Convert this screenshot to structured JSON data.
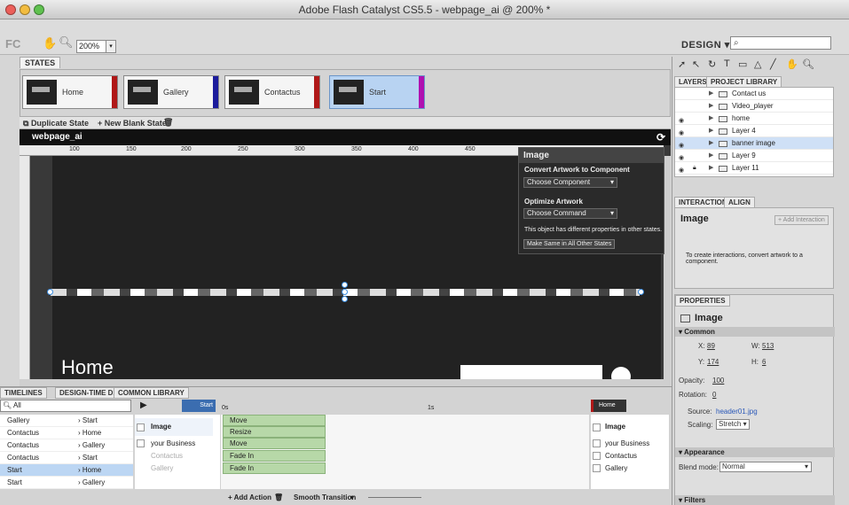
{
  "window": {
    "title": "Adobe Flash Catalyst CS5.5 - webpage_ai @ 200% *"
  },
  "toolbar": {
    "logo": "FC",
    "zoom": "200%",
    "workspace": "DESIGN",
    "search_placeholder": ""
  },
  "states": {
    "tab": "STATES",
    "cards": [
      {
        "label": "Home",
        "color": "#b01818"
      },
      {
        "label": "Gallery",
        "color": "#1c1c9c"
      },
      {
        "label": "Contactus",
        "color": "#b01818"
      },
      {
        "label": "Start",
        "color": "#b010b0"
      }
    ],
    "duplicate": "Duplicate State",
    "new_blank": "New Blank State"
  },
  "canvas": {
    "doc_name": "webpage_ai",
    "ruler_ticks": [
      "100",
      "150",
      "200",
      "250",
      "300",
      "350",
      "400",
      "450"
    ],
    "home_text": "Home"
  },
  "hud": {
    "title": "Image",
    "section1": "Convert Artwork to Component",
    "choose_component": "Choose Component",
    "section2": "Optimize Artwork",
    "choose_command": "Choose Command",
    "message": "This object has different properties in other states.",
    "make_same": "Make Same in All Other States"
  },
  "right_panel": {
    "tabs": [
      "LAYERS",
      "PROJECT LIBRARY"
    ],
    "layers": [
      {
        "name": "Contact us",
        "eye": false,
        "lock": false,
        "selected": false
      },
      {
        "name": "Video_player",
        "eye": false,
        "lock": false,
        "selected": false
      },
      {
        "name": "home",
        "eye": true,
        "lock": false,
        "selected": false
      },
      {
        "name": "Layer 4",
        "eye": true,
        "lock": false,
        "selected": false
      },
      {
        "name": "banner image",
        "eye": true,
        "lock": false,
        "selected": true
      },
      {
        "name": "Layer 9",
        "eye": true,
        "lock": false,
        "selected": false
      },
      {
        "name": "Layer 11",
        "eye": true,
        "lock": true,
        "selected": false
      }
    ],
    "interaction_tabs": [
      "INTERACTIONS",
      "ALIGN"
    ],
    "interaction_title": "Image",
    "add_interaction": "+ Add Interaction",
    "interaction_msg": "To create interactions, convert artwork to a component.",
    "properties_tab": "PROPERTIES",
    "properties_title": "Image",
    "common": "Common",
    "x_label": "X:",
    "x": "89",
    "w_label": "W:",
    "w": "513",
    "y_label": "Y:",
    "y": "174",
    "h_label": "H:",
    "h": "6",
    "opacity_label": "Opacity:",
    "opacity": "100",
    "rotation_label": "Rotation:",
    "rotation": "0",
    "source_label": "Source:",
    "source": "header01.jpg",
    "scaling_label": "Scaling:",
    "scaling": "Stretch",
    "appearance": "Appearance",
    "blend_label": "Blend mode:",
    "blend": "Normal",
    "filters": "Filters"
  },
  "timelines": {
    "tabs": [
      "TIMELINES",
      "DESIGN-TIME DATA",
      "COMMON LIBRARY"
    ],
    "filter": "All",
    "start_label": "Start",
    "home_label": "Home",
    "time_0": "0s",
    "time_1": "1s",
    "transitions": [
      {
        "from": "Gallery",
        "to": "Start"
      },
      {
        "from": "Contactus",
        "to": "Home"
      },
      {
        "from": "Contactus",
        "to": "Gallery"
      },
      {
        "from": "Contactus",
        "to": "Start"
      },
      {
        "from": "Start",
        "to": "Home"
      },
      {
        "from": "Start",
        "to": "Gallery"
      }
    ],
    "objects_left": [
      "Image",
      "your Business",
      "Contactus",
      "Gallery"
    ],
    "actions": [
      "Move",
      "Resize",
      "Move",
      "Fade In",
      "Fade In"
    ],
    "objects_right": [
      "Image",
      "your Business",
      "Contactus",
      "Gallery"
    ],
    "add_action": "Add Action",
    "smooth_transition": "Smooth Transition"
  }
}
